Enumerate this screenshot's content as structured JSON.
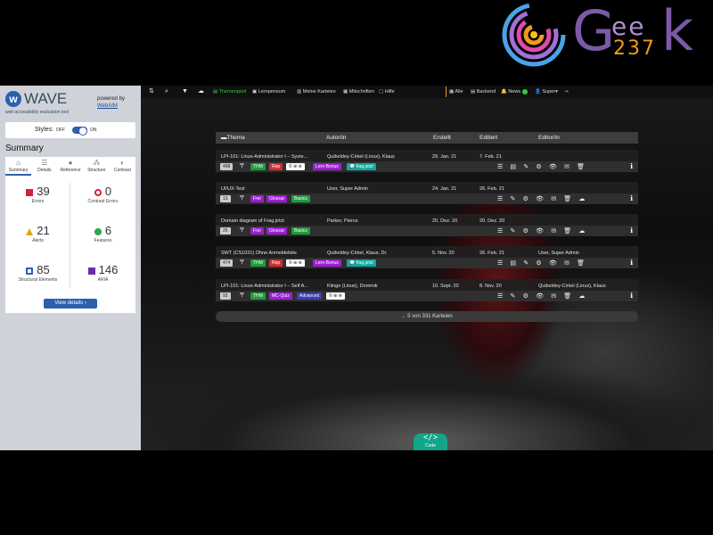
{
  "logo": {
    "g": "G",
    "ee": "ee",
    "num": "237",
    "k": "k"
  },
  "wave": {
    "name": "WAVE",
    "subtitle": "web accessibility evaluation tool",
    "powered_by": "powered by",
    "webaim": "WebAIM",
    "styles_label": "Styles:",
    "styles_off": "OFF",
    "styles_on": "ON",
    "styles_on_state": true,
    "summary_title": "Summary",
    "tabs": [
      {
        "label": "Summary",
        "icon": "home-icon"
      },
      {
        "label": "Details",
        "icon": "list-icon"
      },
      {
        "label": "Reference",
        "icon": "info-icon"
      },
      {
        "label": "Structure",
        "icon": "hierarchy-icon"
      },
      {
        "label": "Contrast",
        "icon": "contrast-icon"
      }
    ],
    "stats": [
      {
        "value": "39",
        "label": "Errors",
        "icon": "error-icon",
        "color": "#d0223a"
      },
      {
        "value": "0",
        "label": "Contrast Errors",
        "icon": "contrast-error-icon",
        "color": "#d0223a"
      },
      {
        "value": "21",
        "label": "Alerts",
        "icon": "alert-icon",
        "color": "#e6a400"
      },
      {
        "value": "6",
        "label": "Features",
        "icon": "feature-icon",
        "color": "#2aa84a"
      },
      {
        "value": "85",
        "label": "Structural Elements",
        "icon": "structure-icon",
        "color": "#2b5fb0"
      },
      {
        "value": "146",
        "label": "ARIA",
        "icon": "aria-icon",
        "color": "#6a2ca8"
      }
    ],
    "view_details": "View details ›"
  },
  "topbar": {
    "items": [
      {
        "label": "Themenpool",
        "icon": "list-icon",
        "active": true
      },
      {
        "label": "Lernpensum",
        "icon": "book-icon"
      },
      {
        "label": "Meine Karteien",
        "icon": "cards-icon"
      },
      {
        "label": "Mitschriften",
        "icon": "notes-icon"
      },
      {
        "label": "Hilfe",
        "icon": "help-icon"
      },
      {
        "label": "Alle",
        "icon": "grid-icon"
      },
      {
        "label": "Backend",
        "icon": "table-icon"
      },
      {
        "label": "News",
        "icon": "bell-icon"
      },
      {
        "label": "Super",
        "icon": "user-icon"
      }
    ],
    "accent": "#f29a18"
  },
  "table": {
    "headers": [
      "Thema",
      "Autor/in",
      "Erstellt",
      "Editiert",
      "Editor/in"
    ],
    "rows": [
      {
        "title": "LPI-101: Linux-Administrator I – Syste...",
        "author": "Quibeldey-Cirkel (Linux), Klaus",
        "created": "29. Jan. 21",
        "edited": "7. Feb. 21",
        "editor": "",
        "count": "498",
        "tags": [
          {
            "t": "THM",
            "c": "tg"
          },
          {
            "t": "Rep",
            "c": "tr"
          },
          {
            "t": "© ⊛ ⊜",
            "c": "tw"
          },
          {
            "t": "Lern-Bonus",
            "c": "tp"
          },
          {
            "t": "💬 frag.jetzt",
            "c": "tt"
          }
        ]
      },
      {
        "title": "UI/UX-Test",
        "author": "User, Super Admin",
        "created": "24. Jan. 21",
        "edited": "26. Feb. 21",
        "editor": "",
        "count": "13",
        "tags": [
          {
            "t": "Frei",
            "c": "tp"
          },
          {
            "t": "Glossar",
            "c": "tp"
          },
          {
            "t": "Basics",
            "c": "tg"
          }
        ]
      },
      {
        "title": "Domain diagram of Frag.jetzt",
        "author": "Parker, Pierce",
        "created": "20. Dez. 20",
        "edited": "20. Dez. 20",
        "editor": "",
        "count": "26",
        "tags": [
          {
            "t": "Frei",
            "c": "tp"
          },
          {
            "t": "Glossar",
            "c": "tp"
          },
          {
            "t": "Basics",
            "c": "tg"
          }
        ]
      },
      {
        "title": "SWT (CS1021) Ohne Anmeldeliste",
        "author": "Quibeldey-Cirkel, Klaus, Dr.",
        "created": "5. Nov. 20",
        "edited": "26. Feb. 21",
        "editor": "User, Super Admin",
        "count": "474",
        "tags": [
          {
            "t": "THM",
            "c": "tg"
          },
          {
            "t": "Rep",
            "c": "tr"
          },
          {
            "t": "© ⊛ ⊜",
            "c": "tw"
          },
          {
            "t": "Lern-Bonus",
            "c": "tp"
          },
          {
            "t": "💬 frag.jetzt",
            "c": "tt"
          }
        ]
      },
      {
        "title": "LPI-101: Linux-Administrator I – Self A...",
        "author": "Klinge (Linux), Dominik",
        "created": "10. Sept. 20",
        "edited": "8. Nov. 20",
        "editor": "Quibeldey-Cirkel (Linux), Klaus",
        "count": "93",
        "tags": [
          {
            "t": "THM",
            "c": "tg"
          },
          {
            "t": "MC-Quiz",
            "c": "tp"
          },
          {
            "t": "Advanced",
            "c": "tb"
          },
          {
            "t": "© ⊛ ⊜",
            "c": "tw"
          }
        ]
      }
    ],
    "more": "5 von 331 Karteien"
  },
  "code_button": {
    "symbol": "</>",
    "label": "Code"
  }
}
